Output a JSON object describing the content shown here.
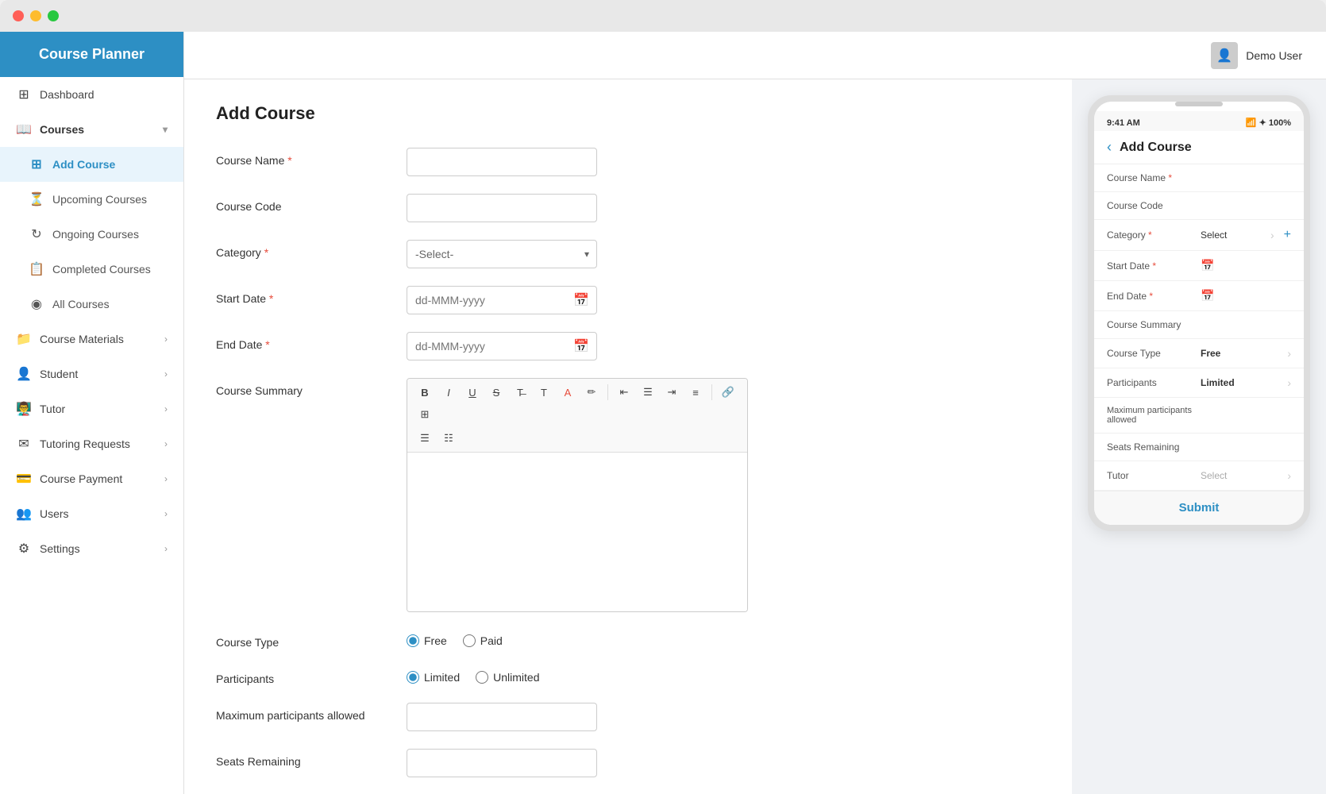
{
  "window": {
    "dots": [
      "red",
      "yellow",
      "green"
    ]
  },
  "sidebar": {
    "logo": "Course Planner",
    "items": [
      {
        "id": "dashboard",
        "label": "Dashboard",
        "icon": "⊞",
        "type": "item"
      },
      {
        "id": "courses",
        "label": "Courses",
        "icon": "📖",
        "type": "section",
        "expanded": true
      },
      {
        "id": "add-course",
        "label": "Add Course",
        "icon": "+",
        "type": "sub",
        "active": true
      },
      {
        "id": "upcoming-courses",
        "label": "Upcoming Courses",
        "icon": "⏳",
        "type": "sub"
      },
      {
        "id": "ongoing-courses",
        "label": "Ongoing Courses",
        "icon": "🔄",
        "type": "sub"
      },
      {
        "id": "completed-courses",
        "label": "Completed Courses",
        "icon": "📋",
        "type": "sub"
      },
      {
        "id": "all-courses",
        "label": "All Courses",
        "icon": "◉",
        "type": "sub"
      },
      {
        "id": "course-materials",
        "label": "Course Materials",
        "icon": "📁",
        "type": "item",
        "hasArrow": true
      },
      {
        "id": "student",
        "label": "Student",
        "icon": "👤",
        "type": "item",
        "hasArrow": true
      },
      {
        "id": "tutor",
        "label": "Tutor",
        "icon": "👨‍🏫",
        "type": "item",
        "hasArrow": true
      },
      {
        "id": "tutoring-requests",
        "label": "Tutoring Requests",
        "icon": "✉",
        "type": "item",
        "hasArrow": true
      },
      {
        "id": "course-payment",
        "label": "Course Payment",
        "icon": "💳",
        "type": "item",
        "hasArrow": true
      },
      {
        "id": "users",
        "label": "Users",
        "icon": "👥",
        "type": "item",
        "hasArrow": true
      },
      {
        "id": "settings",
        "label": "Settings",
        "icon": "⚙",
        "type": "item",
        "hasArrow": true
      }
    ]
  },
  "header": {
    "user_name": "Demo User",
    "user_icon": "👤"
  },
  "form": {
    "page_title": "Add Course",
    "fields": {
      "course_name_label": "Course Name",
      "course_code_label": "Course Code",
      "category_label": "Category",
      "category_placeholder": "-Select-",
      "start_date_label": "Start Date",
      "start_date_placeholder": "dd-MMM-yyyy",
      "end_date_label": "End Date",
      "end_date_placeholder": "dd-MMM-yyyy",
      "course_summary_label": "Course Summary",
      "course_type_label": "Course Type",
      "participants_label": "Participants",
      "max_participants_label": "Maximum participants allowed",
      "seats_remaining_label": "Seats Remaining"
    },
    "course_type_options": [
      {
        "value": "free",
        "label": "Free",
        "checked": true
      },
      {
        "value": "paid",
        "label": "Paid",
        "checked": false
      }
    ],
    "participants_options": [
      {
        "value": "limited",
        "label": "Limited",
        "checked": true
      },
      {
        "value": "unlimited",
        "label": "Unlimited",
        "checked": false
      }
    ],
    "toolbar_buttons": [
      {
        "id": "bold",
        "label": "B",
        "style": "font-weight:bold"
      },
      {
        "id": "italic",
        "label": "I",
        "style": "font-style:italic"
      },
      {
        "id": "underline",
        "label": "U",
        "style": "text-decoration:underline"
      },
      {
        "id": "strikethrough",
        "label": "S̶",
        "style": ""
      },
      {
        "id": "code",
        "label": "T",
        "style": ""
      },
      {
        "id": "font-color",
        "label": "A",
        "style": ""
      },
      {
        "id": "highlight",
        "label": "✏",
        "style": ""
      },
      {
        "id": "align-left",
        "label": "≡",
        "style": ""
      },
      {
        "id": "align-center",
        "label": "≡",
        "style": ""
      },
      {
        "id": "align-right",
        "label": "≡",
        "style": ""
      },
      {
        "id": "justify",
        "label": "≡",
        "style": ""
      },
      {
        "id": "link",
        "label": "🔗",
        "style": ""
      },
      {
        "id": "table",
        "label": "⊞",
        "style": ""
      },
      {
        "id": "unordered-list",
        "label": "☰",
        "style": ""
      },
      {
        "id": "ordered-list",
        "label": "☰",
        "style": ""
      }
    ]
  },
  "mobile_preview": {
    "status_bar": {
      "time": "9:41 AM",
      "battery": "100%",
      "signal": "📶"
    },
    "title": "Add Course",
    "back_label": "‹",
    "fields": [
      {
        "label": "Course Name",
        "required": true,
        "value": "",
        "type": "input"
      },
      {
        "label": "Course Code",
        "required": false,
        "value": "",
        "type": "input"
      },
      {
        "label": "Category",
        "required": true,
        "value": "Select",
        "type": "select"
      },
      {
        "label": "Start Date",
        "required": true,
        "value": "",
        "type": "date"
      },
      {
        "label": "End Date",
        "required": true,
        "value": "",
        "type": "date"
      },
      {
        "label": "Course Summary",
        "required": false,
        "value": "",
        "type": "textarea"
      },
      {
        "label": "Course Type",
        "required": false,
        "value": "Free",
        "type": "select"
      },
      {
        "label": "Participants",
        "required": false,
        "value": "Limited",
        "type": "select"
      },
      {
        "label": "Maximum participants allowed",
        "required": false,
        "value": "",
        "type": "input"
      },
      {
        "label": "Seats Remaining",
        "required": false,
        "value": "",
        "type": "input"
      },
      {
        "label": "Tutor",
        "required": false,
        "value": "Select",
        "type": "select"
      }
    ],
    "submit_label": "Submit"
  }
}
